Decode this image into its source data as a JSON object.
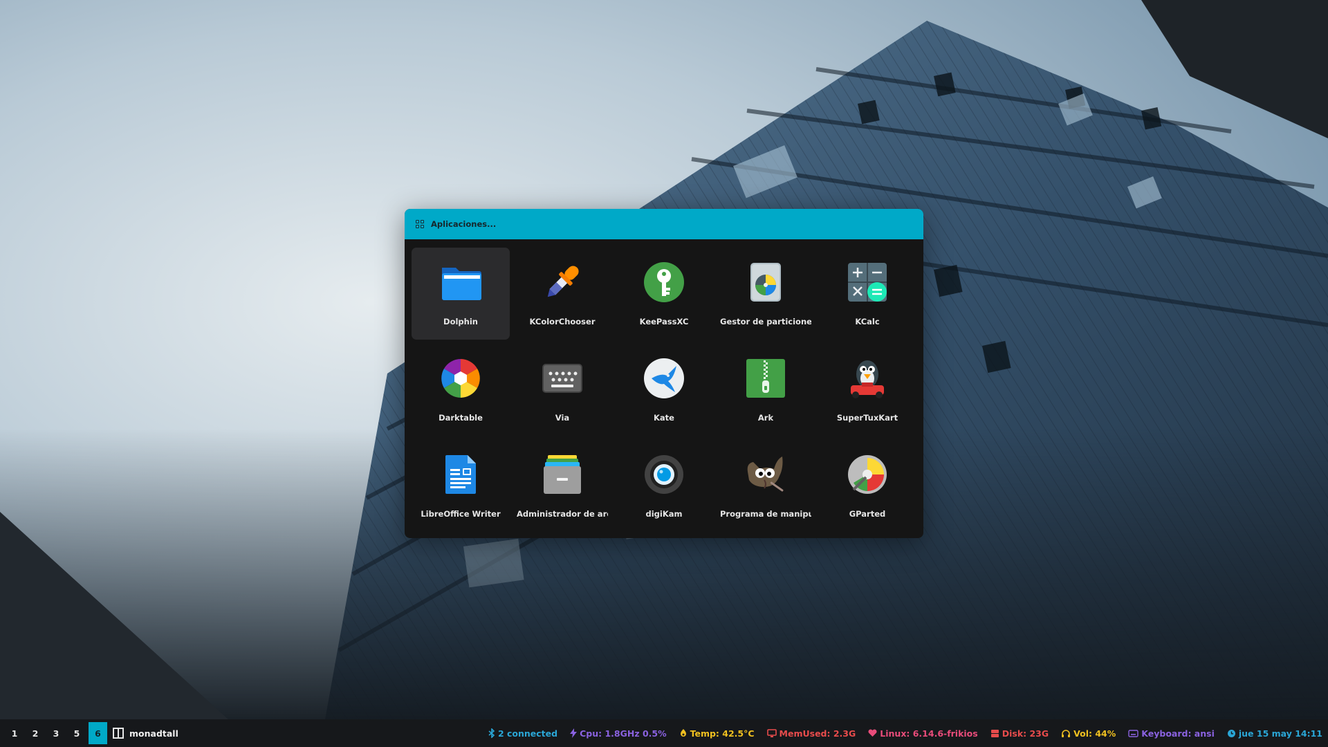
{
  "launcher": {
    "title": "Aplicaciones...",
    "apps": [
      {
        "label": "Dolphin",
        "icon": "folder-icon",
        "selected": true
      },
      {
        "label": "KColorChooser",
        "icon": "color-picker-icon"
      },
      {
        "label": "KeePassXC",
        "icon": "keepassxc-key-icon"
      },
      {
        "label": "Gestor de particione...",
        "icon": "partition-manager-disk-icon"
      },
      {
        "label": "KCalc",
        "icon": "calculator-icon"
      },
      {
        "label": "Darktable",
        "icon": "darktable-aperture-icon"
      },
      {
        "label": "Via",
        "icon": "keyboard-icon"
      },
      {
        "label": "Kate",
        "icon": "kate-bird-icon"
      },
      {
        "label": "Ark",
        "icon": "archive-zipper-icon"
      },
      {
        "label": "SuperTuxKart",
        "icon": "supertuxkart-tux-icon"
      },
      {
        "label": "LibreOffice Writer",
        "icon": "writer-document-icon"
      },
      {
        "label": "Administrador de arc...",
        "icon": "file-cabinet-icon"
      },
      {
        "label": "digiKam",
        "icon": "digikam-lens-icon"
      },
      {
        "label": "Programa de manipu...",
        "icon": "gimp-wilber-icon"
      },
      {
        "label": "GParted",
        "icon": "gparted-disk-icon"
      }
    ]
  },
  "bar": {
    "workspaces": [
      {
        "label": "1",
        "active": false
      },
      {
        "label": "2",
        "active": false
      },
      {
        "label": "3",
        "active": false
      },
      {
        "label": "5",
        "active": false
      },
      {
        "label": "6",
        "active": true
      }
    ],
    "layout_name": "monadtall",
    "widgets": [
      {
        "icon": "bluetooth-icon",
        "text": "2 connected",
        "color": "#2aa6d6"
      },
      {
        "icon": "bolt-icon",
        "text": "Cpu: 1.8GHz 0.5%",
        "color": "#8a62e0"
      },
      {
        "icon": "thermometer-icon",
        "text": "Temp: 42.5°C",
        "color": "#f0c020"
      },
      {
        "icon": "monitor-icon",
        "text": "MemUsed: 2.3G",
        "color": "#e84c4c"
      },
      {
        "icon": "heart-icon",
        "text": "Linux: 6.14.6-frikios",
        "color": "#e84c7a"
      },
      {
        "icon": "disk-icon",
        "text": "Disk: 23G",
        "color": "#e84c4c"
      },
      {
        "icon": "headphones-icon",
        "text": "Vol: 44%",
        "color": "#f0c020"
      },
      {
        "icon": "keyboard-small-icon",
        "text": "Keyboard: ansi",
        "color": "#8a62e0"
      },
      {
        "icon": "clock-icon",
        "text": "jue 15 may 14:11",
        "color": "#2aa6d6"
      }
    ]
  },
  "colors": {
    "accent": "#00a9c8",
    "launcher_bg": "#151515",
    "bar_bg": "#16181b"
  }
}
